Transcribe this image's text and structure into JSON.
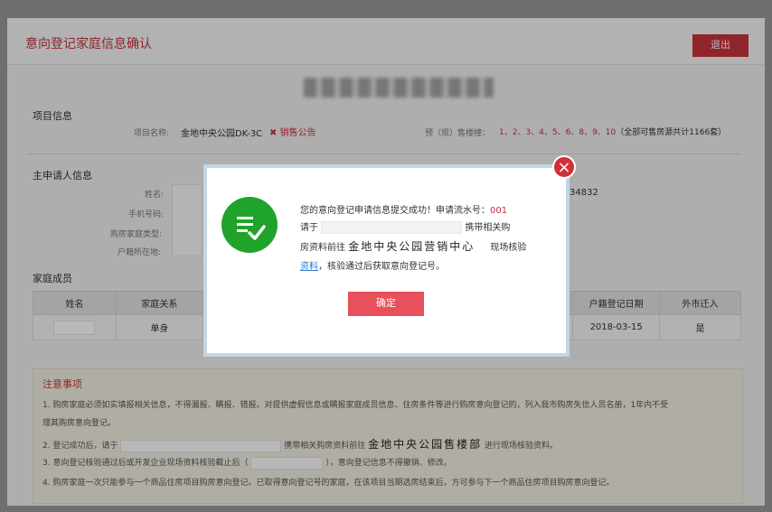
{
  "header": {
    "title": "意向登记家庭信息确认",
    "logout_label": "退出"
  },
  "project": {
    "section_title": "项目信息",
    "name_label": "项目名称:",
    "name_value": "金地中央公园DK-3C",
    "sales_notice_label": "销售公告",
    "buildings_label": "预（现）售楼幢：",
    "buildings_value": "1、2、3、4、5、6、8、9、10",
    "buildings_note": "（全部可售房源共计1166套）"
  },
  "applicant": {
    "section_title": "主申请人信息",
    "name_label": "姓名:",
    "phone_label": "手机号码:",
    "type_label": "购房家庭类型:",
    "hukou_label": "户籍所在地:",
    "id_partial": "34832"
  },
  "family": {
    "section_title": "家庭成员",
    "columns": [
      "姓名",
      "家庭关系",
      "户籍登记日期",
      "外市迁入"
    ],
    "row": {
      "relation": "单身",
      "reg_date": "2018-03-15",
      "moved_in": "是"
    }
  },
  "notice": {
    "title": "注意事项",
    "item1": "1. 购房家庭必须如实填报相关信息，不得漏报、瞒报、错报。对提供虚假信息或瞒报家庭成员信息、住房条件等进行购房意向登记的，列入我市购房失信人员名册，1年内不受",
    "item1b": "理其购房意向登记。",
    "item2_a": "2. 登记成功后，请于",
    "item2_b": "携带相关购房资料前往",
    "item2_place": "金地中央公园售楼部",
    "item2_c": "进行现场核验资料。",
    "item3_a": "3. 意向登记核验通过后或开发企业现场资料核验截止后（",
    "item3_b": "），意向登记信息不得撤销、修改。",
    "item4": "4. 购房家庭一次只能参与一个商品住房项目购房意向登记。已取得意向登记号的家庭，在该项目当期选房结束后，方可参与下一个商品住房项目购房意向登记。"
  },
  "modal": {
    "line1": "您的意向登记申请信息提交成功！申请流水号：",
    "serial": "001",
    "line2_a": "请于",
    "line2_b": "携带相关购",
    "line3_a": "房资料前往",
    "line3_place": "金地中央公园营销中心",
    "line3_b": "现场核验",
    "line4_link": "资料",
    "line4_b": "，核验通过后获取意向登记号。",
    "confirm_label": "确定",
    "close_symbol": "×"
  },
  "colors": {
    "accent": "#c8323c",
    "success": "#1fa32a",
    "confirm": "#e8505b",
    "link": "#2a7dd4"
  }
}
